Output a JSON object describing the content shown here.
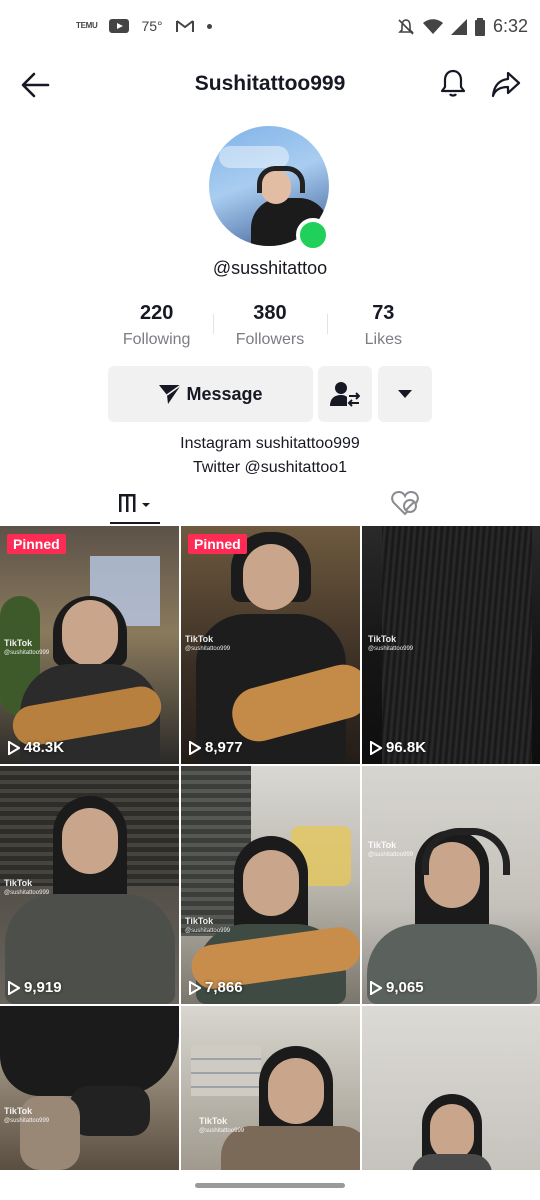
{
  "status_bar": {
    "temu_label": "TEMU",
    "temperature": "75°",
    "time": "6:32"
  },
  "header": {
    "title": "Sushitattoo999"
  },
  "profile": {
    "handle": "@susshitattoo",
    "online_color": "#20d05b"
  },
  "stats": [
    {
      "value": "220",
      "label": "Following"
    },
    {
      "value": "380",
      "label": "Followers"
    },
    {
      "value": "73",
      "label": "Likes"
    }
  ],
  "actions": {
    "message_label": "Message"
  },
  "bio": {
    "line1": "Instagram sushitattoo999",
    "line2": "Twitter @sushitattoo1"
  },
  "videos": [
    {
      "pinned": "Pinned",
      "views": "48.3K",
      "watermark": "TikTok",
      "watermark_user": "@sushitattoo999"
    },
    {
      "pinned": "Pinned",
      "views": "8,977",
      "watermark": "TikTok",
      "watermark_user": "@sushitattoo999"
    },
    {
      "pinned": "",
      "views": "96.8K",
      "watermark": "TikTok",
      "watermark_user": "@sushitattoo999"
    },
    {
      "pinned": "",
      "views": "9,919",
      "watermark": "TikTok",
      "watermark_user": "@sushitattoo999"
    },
    {
      "pinned": "",
      "views": "7,866",
      "watermark": "TikTok",
      "watermark_user": "@sushitattoo999"
    },
    {
      "pinned": "",
      "views": "9,065",
      "watermark": "TikTok",
      "watermark_user": "@sushitattoo999"
    },
    {
      "pinned": "",
      "views": "",
      "watermark": "TikTok",
      "watermark_user": "@sushitattoo999"
    },
    {
      "pinned": "",
      "views": "",
      "watermark": "TikTok",
      "watermark_user": "@sushitattoo999"
    },
    {
      "pinned": "",
      "views": "",
      "watermark": "",
      "watermark_user": ""
    }
  ],
  "colors": {
    "accent_red": "#fe2c55",
    "text": "#161823",
    "muted": "#7b7d83",
    "button_bg": "#f1f1f2"
  }
}
